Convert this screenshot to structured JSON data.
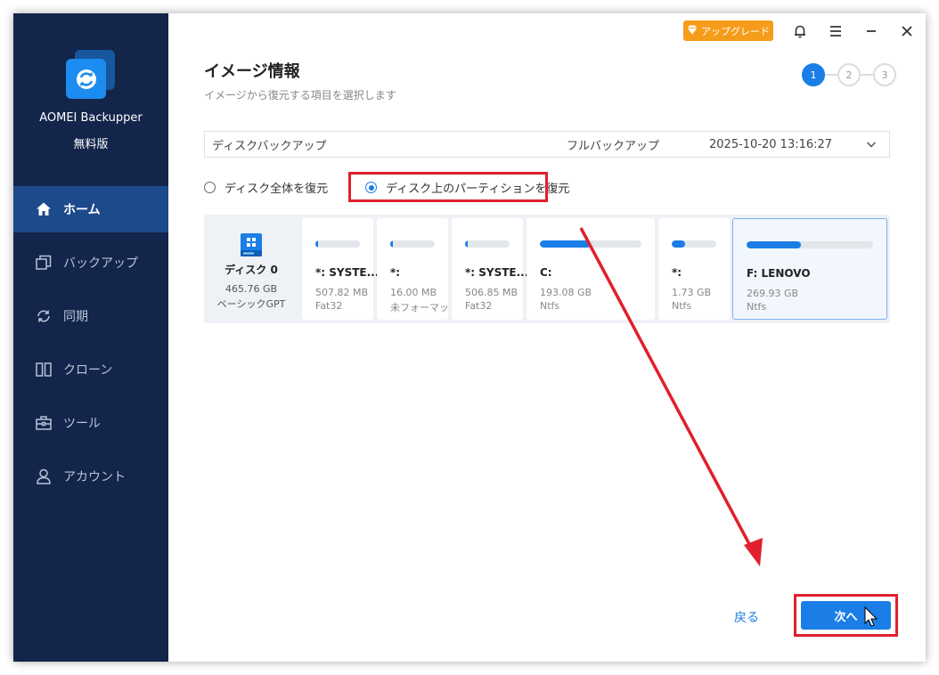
{
  "app": {
    "name": "AOMEI Backupper",
    "edition": "無料版"
  },
  "topbar": {
    "upgrade_label": "アップグレード"
  },
  "sidebar": {
    "items": [
      {
        "label": "ホーム",
        "icon": "home-icon",
        "active": true
      },
      {
        "label": "バックアップ",
        "icon": "backup-icon",
        "active": false
      },
      {
        "label": "同期",
        "icon": "sync-icon",
        "active": false
      },
      {
        "label": "クローン",
        "icon": "clone-icon",
        "active": false
      },
      {
        "label": "ツール",
        "icon": "tools-icon",
        "active": false
      },
      {
        "label": "アカウント",
        "icon": "account-icon",
        "active": false
      }
    ]
  },
  "page": {
    "title": "イメージ情報",
    "subtitle": "イメージから復元する項目を選択します"
  },
  "steps": [
    "1",
    "2",
    "3"
  ],
  "backup": {
    "name": "ディスクバックアップ",
    "type": "フルバックアップ",
    "time": "2025-10-20 13:16:27"
  },
  "restore_options": {
    "whole_disk": "ディスク全体を復元",
    "partitions": "ディスク上のパーティションを復元",
    "selected": "partitions"
  },
  "disk": {
    "name": "ディスク 0",
    "size": "465.76 GB",
    "type": "ベーシックGPT"
  },
  "partitions": [
    {
      "name": "*: SYSTE...",
      "size": "507.82 MB",
      "fs": "Fat32",
      "used": 0.04
    },
    {
      "name": "*:",
      "size": "16.00 MB",
      "fs": "未フォーマット",
      "used": 0.04
    },
    {
      "name": "*: SYSTE...",
      "size": "506.85 MB",
      "fs": "Fat32",
      "used": 0.04
    },
    {
      "name": "C:",
      "size": "193.08 GB",
      "fs": "Ntfs",
      "used": 0.5
    },
    {
      "name": "*:",
      "size": "1.73 GB",
      "fs": "Ntfs",
      "used": 0.3
    },
    {
      "name": "F: LENOVO",
      "size": "269.93 GB",
      "fs": "Ntfs",
      "used": 0.43,
      "selected": true
    }
  ],
  "footer": {
    "back_label": "戻る",
    "next_label": "次へ"
  },
  "colors": {
    "sidebar": "#13254a",
    "accent": "#1a7ee6",
    "highlight": "#e0202c",
    "upgrade": "#f59c1a"
  }
}
